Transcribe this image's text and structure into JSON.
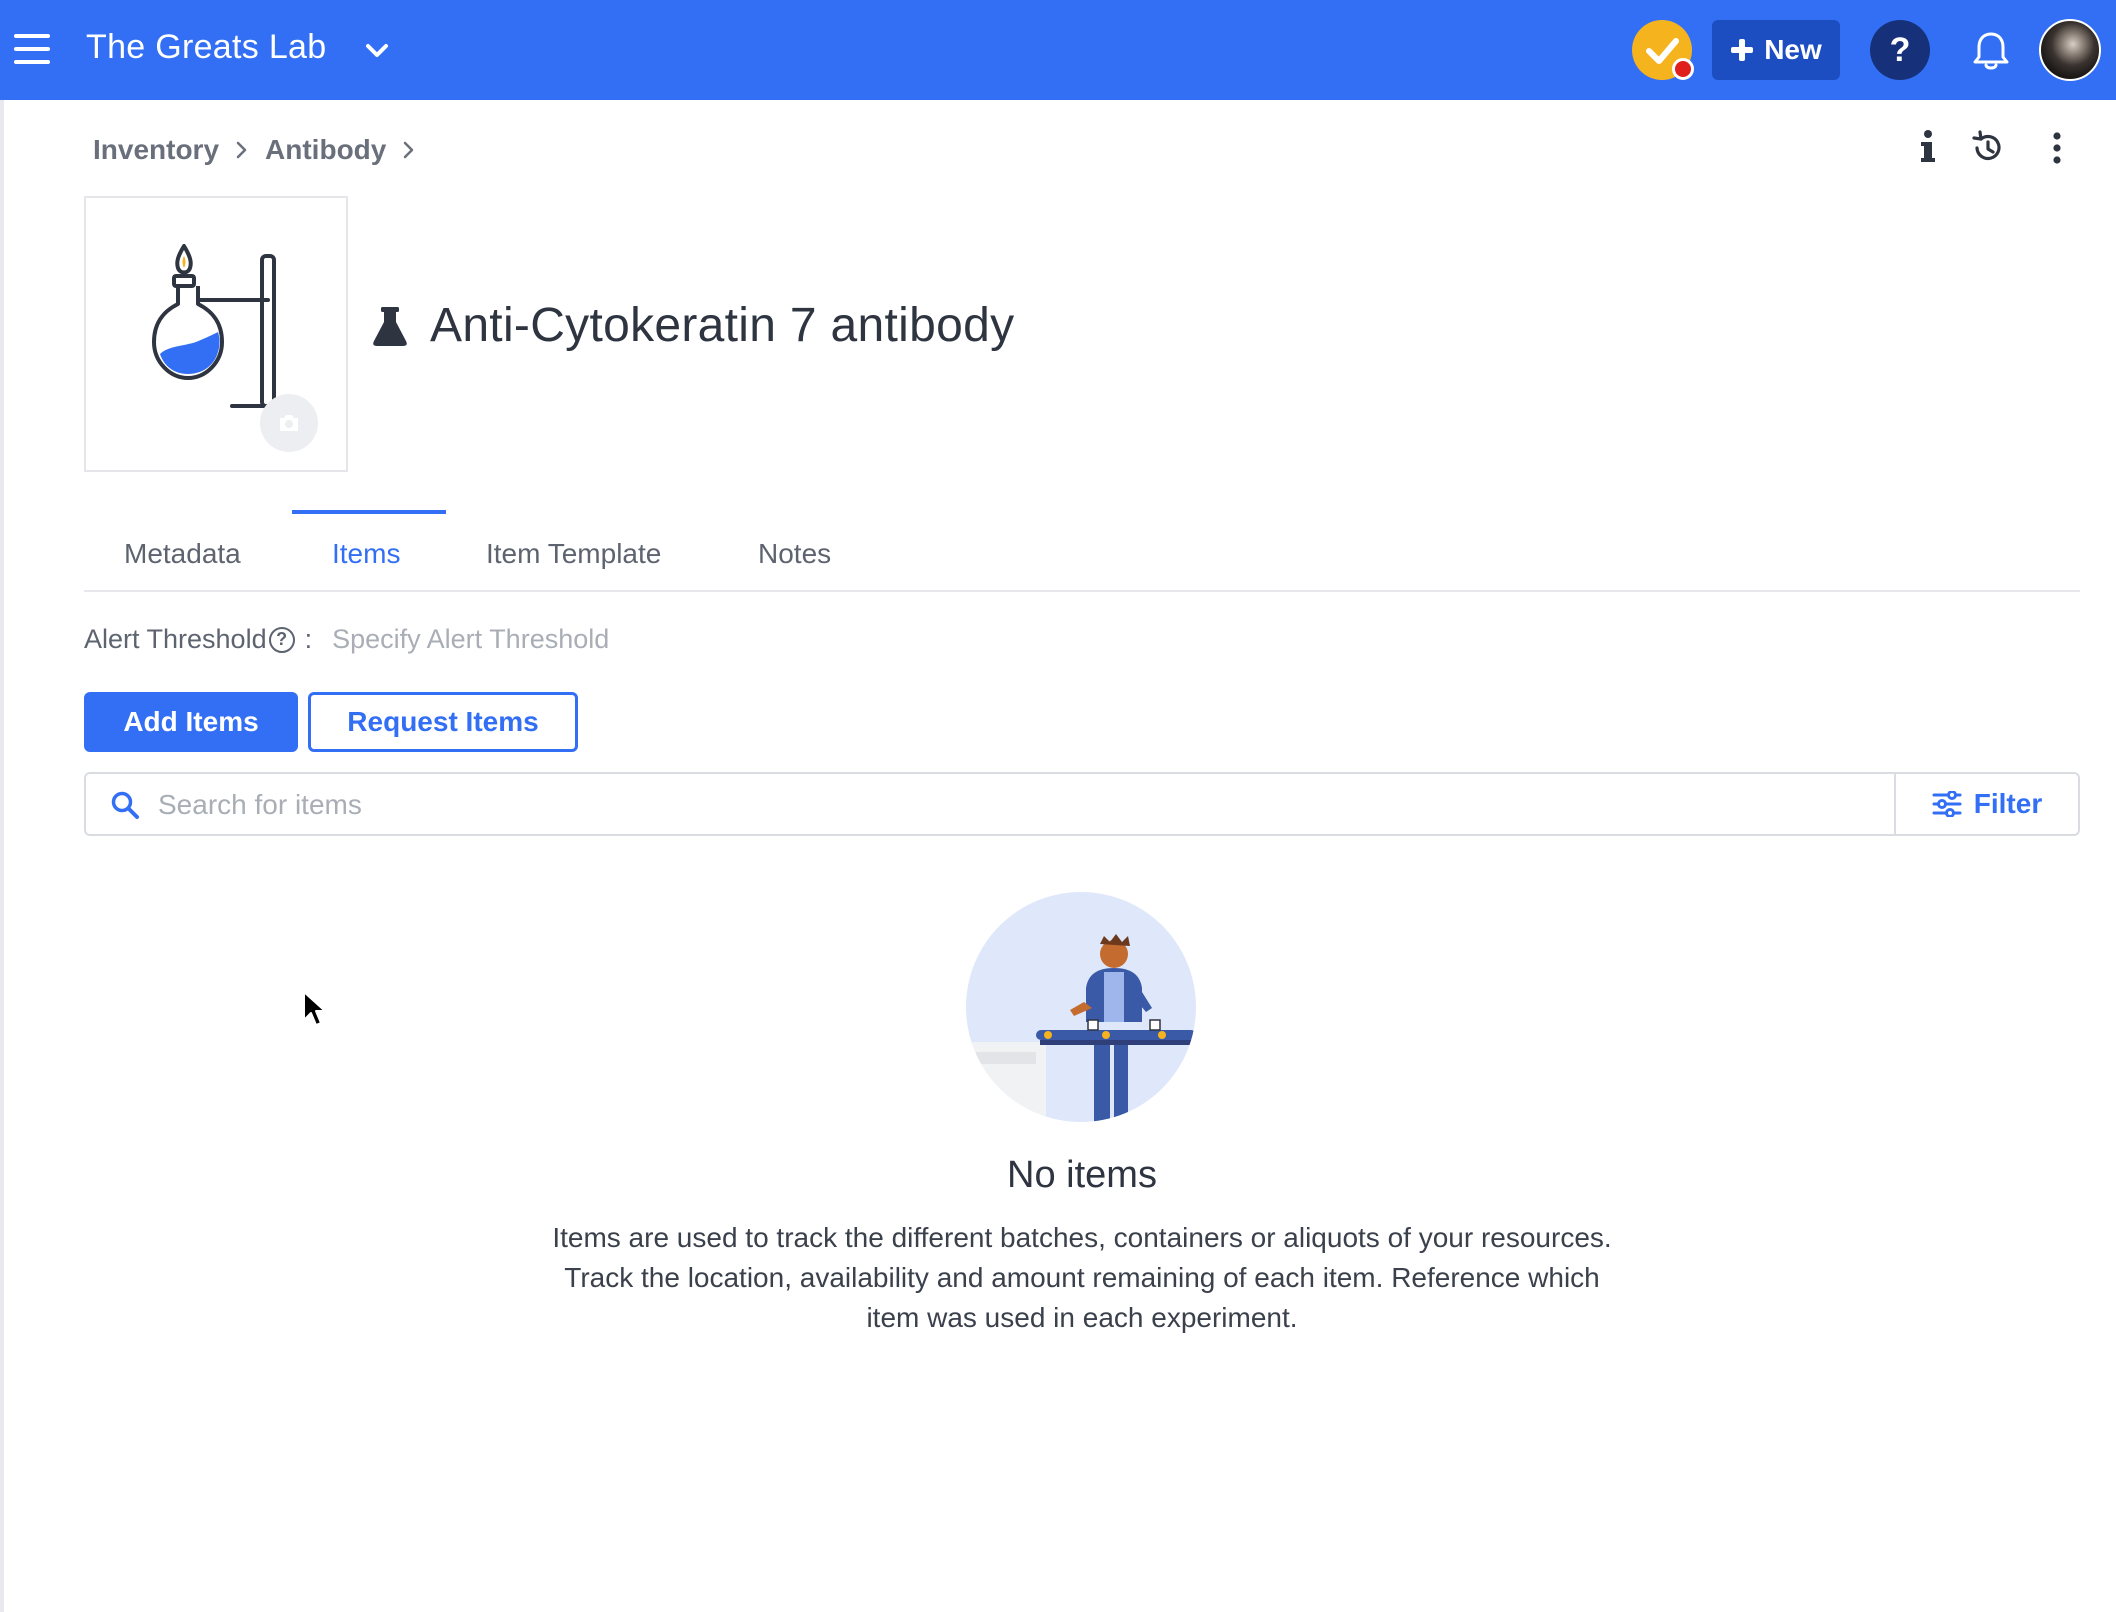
{
  "app": {
    "workspace_name": "The Greats Lab",
    "new_button_label": "New",
    "help_label": "?",
    "accent_color": "#326ff5"
  },
  "breadcrumb": {
    "items": [
      "Inventory",
      "Antibody"
    ]
  },
  "resource": {
    "title": "Anti-Cytokeratin 7 antibody",
    "type_icon": "flask-icon"
  },
  "tabs": {
    "items": [
      "Metadata",
      "Items",
      "Item Template",
      "Notes"
    ],
    "active": "Items"
  },
  "alert_threshold": {
    "label": "Alert Threshold",
    "colon": ":",
    "value_placeholder": "Specify Alert Threshold"
  },
  "actions": {
    "add_items_label": "Add Items",
    "request_items_label": "Request Items"
  },
  "search": {
    "placeholder": "Search for items",
    "filter_label": "Filter"
  },
  "empty_state": {
    "title": "No items",
    "description": "Items are used to track the different batches, containers or aliquots of your resources. Track the location, availability and amount remaining of each item. Reference which item was used in each experiment."
  }
}
